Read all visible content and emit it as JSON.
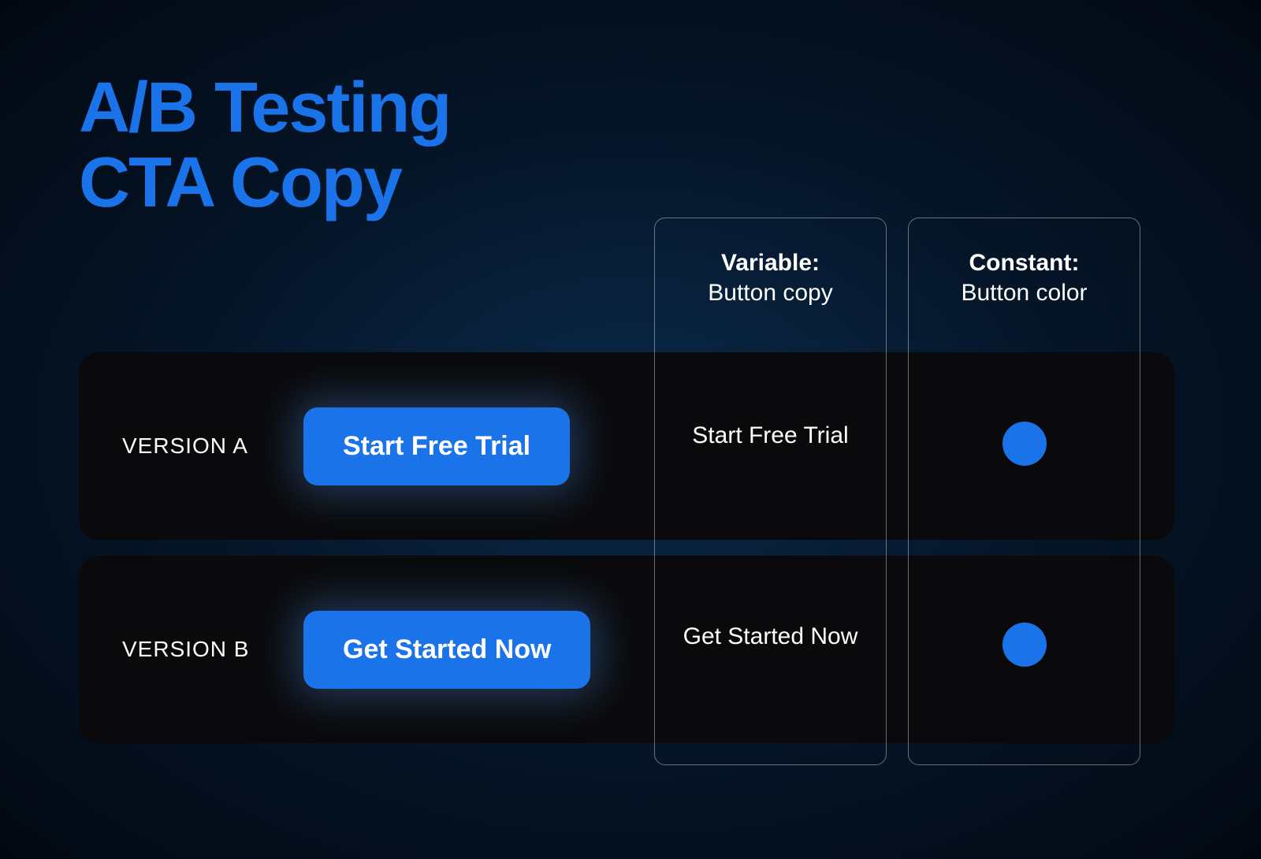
{
  "title_line1": "A/B Testing",
  "title_line2": "CTA Copy",
  "columns": {
    "variable": {
      "header_strong": "Variable:",
      "header_sub": "Button copy"
    },
    "constant": {
      "header_strong": "Constant:",
      "header_sub": "Button color"
    }
  },
  "versions": {
    "a": {
      "label": "VERSION A",
      "cta_text": "Start Free Trial",
      "variable_value": "Start Free Trial",
      "constant_color": "#1a73e8"
    },
    "b": {
      "label": "VERSION B",
      "cta_text": "Get Started Now",
      "variable_value": "Get Started Now",
      "constant_color": "#1a73e8"
    }
  }
}
